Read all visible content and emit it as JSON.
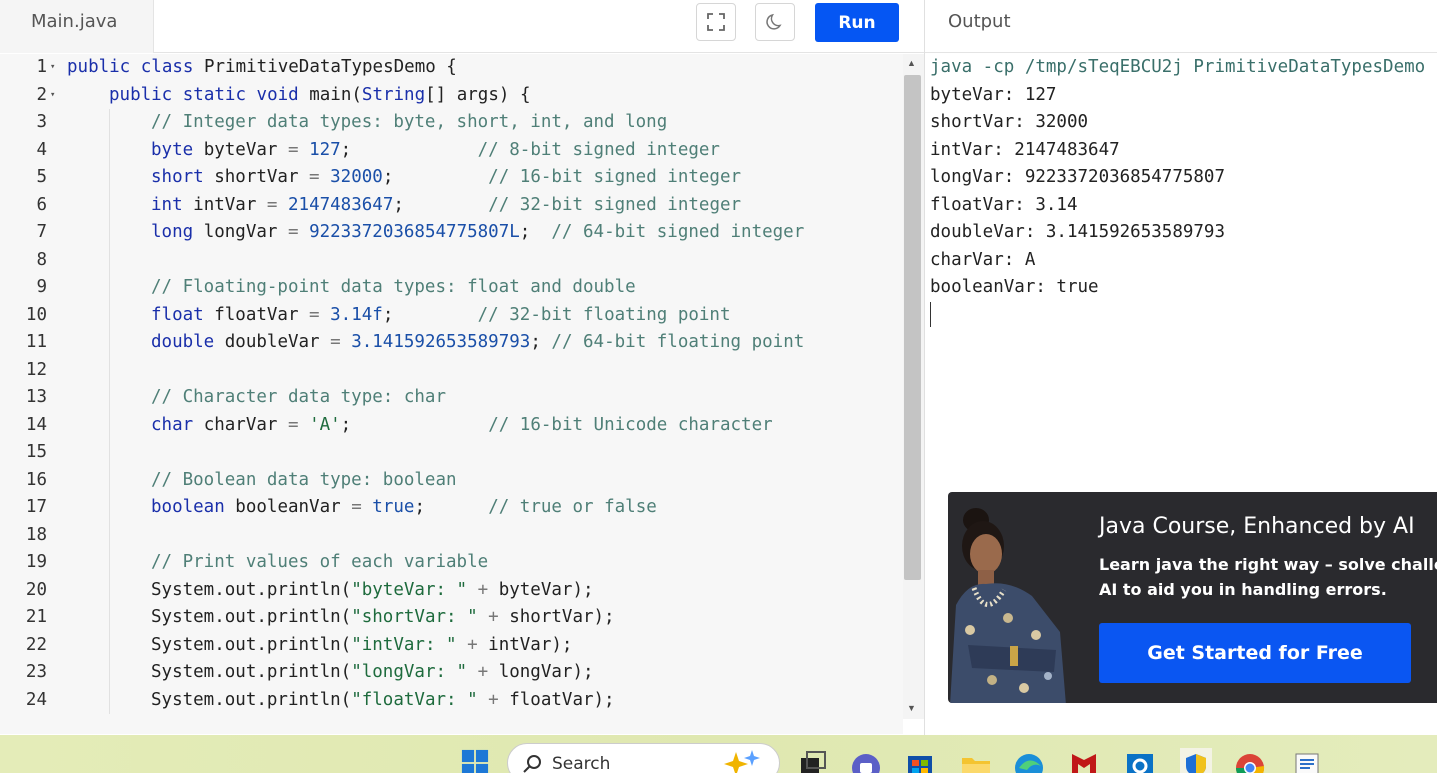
{
  "editor": {
    "tab_label": "Main.java",
    "run_label": "Run",
    "lines": [
      {
        "n": "1",
        "fold": true,
        "indent": 0,
        "tokens": [
          [
            "kw",
            "public "
          ],
          [
            "kw",
            "class "
          ],
          [
            "",
            "PrimitiveDataTypesDemo {"
          ]
        ]
      },
      {
        "n": "2",
        "fold": true,
        "indent": 1,
        "tokens": [
          [
            "kw",
            "public "
          ],
          [
            "kw",
            "static "
          ],
          [
            "kw",
            "void "
          ],
          [
            "",
            "main("
          ],
          [
            "ty",
            "String"
          ],
          [
            "",
            "[] args) {"
          ]
        ]
      },
      {
        "n": "3",
        "indent": 2,
        "tokens": [
          [
            "cm",
            "// Integer data types: byte, short, int, and long"
          ]
        ]
      },
      {
        "n": "4",
        "indent": 2,
        "tokens": [
          [
            "ty",
            "byte "
          ],
          [
            "",
            "byteVar "
          ],
          [
            "op",
            "= "
          ],
          [
            "num",
            "127"
          ],
          [
            "",
            ";            "
          ],
          [
            "cm",
            "// 8-bit signed integer"
          ]
        ]
      },
      {
        "n": "5",
        "indent": 2,
        "tokens": [
          [
            "ty",
            "short "
          ],
          [
            "",
            "shortVar "
          ],
          [
            "op",
            "= "
          ],
          [
            "num",
            "32000"
          ],
          [
            "",
            ";         "
          ],
          [
            "cm",
            "// 16-bit signed integer"
          ]
        ]
      },
      {
        "n": "6",
        "indent": 2,
        "tokens": [
          [
            "ty",
            "int "
          ],
          [
            "",
            "intVar "
          ],
          [
            "op",
            "= "
          ],
          [
            "num",
            "2147483647"
          ],
          [
            "",
            ";        "
          ],
          [
            "cm",
            "// 32-bit signed integer"
          ]
        ]
      },
      {
        "n": "7",
        "indent": 2,
        "tokens": [
          [
            "ty",
            "long "
          ],
          [
            "",
            "longVar "
          ],
          [
            "op",
            "= "
          ],
          [
            "num",
            "9223372036854775807L"
          ],
          [
            "",
            ";  "
          ],
          [
            "cm",
            "// 64-bit signed integer"
          ]
        ]
      },
      {
        "n": "8",
        "indent": 2,
        "tokens": []
      },
      {
        "n": "9",
        "indent": 2,
        "tokens": [
          [
            "cm",
            "// Floating-point data types: float and double"
          ]
        ]
      },
      {
        "n": "10",
        "indent": 2,
        "tokens": [
          [
            "ty",
            "float "
          ],
          [
            "",
            "floatVar "
          ],
          [
            "op",
            "= "
          ],
          [
            "num",
            "3.14f"
          ],
          [
            "",
            ";        "
          ],
          [
            "cm",
            "// 32-bit floating point"
          ]
        ]
      },
      {
        "n": "11",
        "indent": 2,
        "tokens": [
          [
            "ty",
            "double "
          ],
          [
            "",
            "doubleVar "
          ],
          [
            "op",
            "= "
          ],
          [
            "num",
            "3.141592653589793"
          ],
          [
            "",
            "; "
          ],
          [
            "cm",
            "// 64-bit floating point"
          ]
        ]
      },
      {
        "n": "12",
        "indent": 2,
        "tokens": []
      },
      {
        "n": "13",
        "indent": 2,
        "tokens": [
          [
            "cm",
            "// Character data type: char"
          ]
        ]
      },
      {
        "n": "14",
        "indent": 2,
        "tokens": [
          [
            "ty",
            "char "
          ],
          [
            "",
            "charVar "
          ],
          [
            "op",
            "= "
          ],
          [
            "str",
            "'A'"
          ],
          [
            "",
            ";             "
          ],
          [
            "cm",
            "// 16-bit Unicode character"
          ]
        ]
      },
      {
        "n": "15",
        "indent": 2,
        "tokens": []
      },
      {
        "n": "16",
        "indent": 2,
        "tokens": [
          [
            "cm",
            "// Boolean data type: boolean"
          ]
        ]
      },
      {
        "n": "17",
        "indent": 2,
        "tokens": [
          [
            "ty",
            "boolean "
          ],
          [
            "",
            "booleanVar "
          ],
          [
            "op",
            "= "
          ],
          [
            "num",
            "true"
          ],
          [
            "",
            ";      "
          ],
          [
            "cm",
            "// true or false"
          ]
        ]
      },
      {
        "n": "18",
        "indent": 2,
        "tokens": []
      },
      {
        "n": "19",
        "indent": 2,
        "tokens": [
          [
            "cm",
            "// Print values of each variable"
          ]
        ]
      },
      {
        "n": "20",
        "indent": 2,
        "tokens": [
          [
            "",
            "System.out.println("
          ],
          [
            "str",
            "\"byteVar: \""
          ],
          [
            "op",
            " + "
          ],
          [
            "",
            "byteVar);"
          ]
        ]
      },
      {
        "n": "21",
        "indent": 2,
        "tokens": [
          [
            "",
            "System.out.println("
          ],
          [
            "str",
            "\"shortVar: \""
          ],
          [
            "op",
            " + "
          ],
          [
            "",
            "shortVar);"
          ]
        ]
      },
      {
        "n": "22",
        "indent": 2,
        "tokens": [
          [
            "",
            "System.out.println("
          ],
          [
            "str",
            "\"intVar: \""
          ],
          [
            "op",
            " + "
          ],
          [
            "",
            "intVar);"
          ]
        ]
      },
      {
        "n": "23",
        "indent": 2,
        "tokens": [
          [
            "",
            "System.out.println("
          ],
          [
            "str",
            "\"longVar: \""
          ],
          [
            "op",
            " + "
          ],
          [
            "",
            "longVar);"
          ]
        ]
      },
      {
        "n": "24",
        "indent": 2,
        "tokens": [
          [
            "",
            "System.out.println("
          ],
          [
            "str",
            "\"floatVar: \""
          ],
          [
            "op",
            " + "
          ],
          [
            "",
            "floatVar);"
          ]
        ]
      }
    ]
  },
  "output": {
    "header": "Output",
    "lines": [
      {
        "text": "java -cp /tmp/sTeqEBCU2j PrimitiveDataTypesDemo",
        "cmd": true
      },
      {
        "text": "byteVar: 127"
      },
      {
        "text": "shortVar: 32000"
      },
      {
        "text": "intVar: 2147483647"
      },
      {
        "text": "longVar: 9223372036854775807"
      },
      {
        "text": "floatVar: 3.14"
      },
      {
        "text": "doubleVar: 3.141592653589793"
      },
      {
        "text": "charVar: A"
      },
      {
        "text": "booleanVar: true"
      }
    ]
  },
  "ad": {
    "title": "Java Course, Enhanced by AI",
    "text_line1": "Learn java the right way – solve challeng",
    "text_line2": "AI to aid you in handling errors.",
    "button": "Get Started for Free"
  },
  "taskbar": {
    "search_label": "Search",
    "icons": [
      "windows-start-icon",
      "copilot-icon",
      "task-view-icon",
      "teams-icon",
      "store-icon",
      "file-explorer-icon",
      "edge-icon",
      "mcafee-icon",
      "outlook-icon",
      "security-icon",
      "chrome-icon",
      "notepad-icon"
    ]
  },
  "colors": {
    "run_button": "#0556f3",
    "keyword": "#1a2faa",
    "comment": "#4f7f77",
    "ad_background": "#2a2a2e",
    "taskbar": "#e2eab4"
  }
}
